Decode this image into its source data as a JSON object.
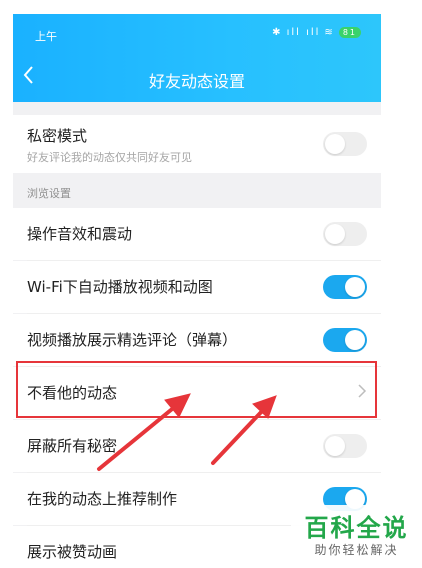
{
  "status_bar": {
    "time": "上午",
    "signal": "ıll ıll",
    "battery": "81"
  },
  "header": {
    "title": "好友动态设置"
  },
  "private_mode": {
    "label": "私密模式",
    "sub": "好友评论我的动态仅共同好友可见",
    "on": false
  },
  "browse_section": {
    "label": "浏览设置"
  },
  "rows": [
    {
      "label": "操作音效和震动",
      "on": false
    },
    {
      "label": "Wi-Fi下自动播放视频和动图",
      "on": true
    },
    {
      "label": "视频播放展示精选评论（弹幕）",
      "on": true
    },
    {
      "label": "不看他的动态"
    },
    {
      "label": "屏蔽所有秘密",
      "on": false
    },
    {
      "label": "在我的动态上推荐制作",
      "on": true
    },
    {
      "label": "展示被赞动画"
    }
  ],
  "watermark": {
    "title": "百科全说",
    "subtitle": "助你轻松解决"
  },
  "colors": {
    "accent": "#1ba8ef",
    "highlight": "#e6353a",
    "header": "#1ab1ff"
  }
}
